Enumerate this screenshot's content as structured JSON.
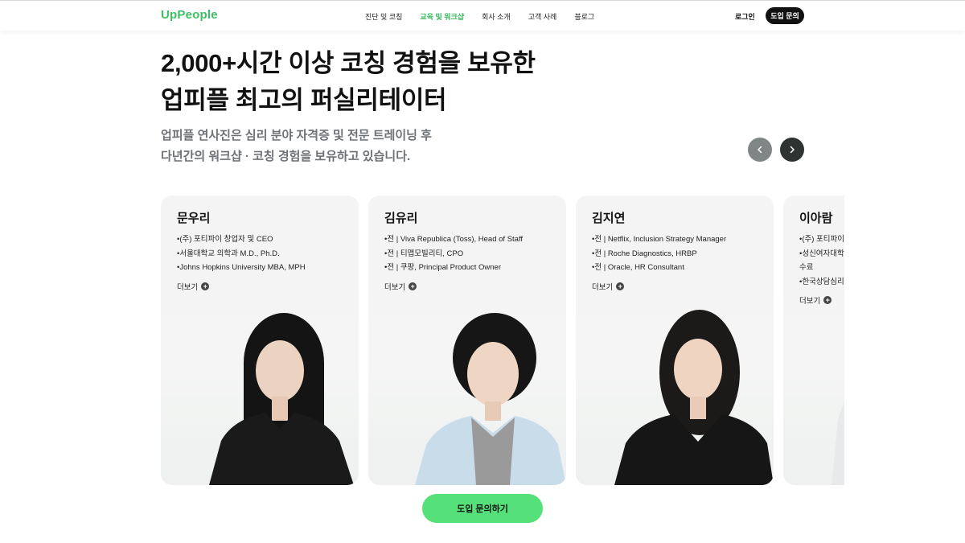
{
  "header": {
    "logo": "UpPeople",
    "nav": [
      {
        "label": "진단 및 코칭"
      },
      {
        "label": "교육 및 워크샵"
      },
      {
        "label": "회사 소개"
      },
      {
        "label": "고객 사례"
      },
      {
        "label": "블로그"
      }
    ],
    "active_nav": "교육 및 워크샵",
    "login": "로그인",
    "cta": "도입 문의"
  },
  "hero": {
    "line1": "2,000+시간 이상 코칭 경험을 보유한",
    "line2": "업피플 최고의 퍼실리테이터",
    "sub1": "업피플 연사진은 심리 분야 자격증 및 전문 트레이닝 후",
    "sub2": "다년간의 워크샵 · 코칭 경험을 보유하고 있습니다."
  },
  "carousel": {
    "prev_icon": "chevron-left-icon",
    "next_icon": "chevron-right-icon",
    "cards": [
      {
        "name": "문우리",
        "bullets": [
          "•(주) 포티파이 창업자 및 CEO",
          "•서울대학교 의학과 M.D., Ph.D.",
          "•Johns Hopkins University MBA, MPH"
        ],
        "more": "더보기"
      },
      {
        "name": "김유리",
        "bullets": [
          "•전 | Viva Republica (Toss), Head of Staff",
          "•전 | 티맵모빌리티, CPO",
          "•전 | 쿠팡, Principal Product Owner"
        ],
        "more": "더보기"
      },
      {
        "name": "김지연",
        "bullets": [
          "•전 | Netflix, Inclusion Strategy Manager",
          "•전 | Roche Diagnostics, HRBP",
          "•전 | Oracle, HR Consultant"
        ],
        "more": "더보기"
      },
      {
        "name": "이아람",
        "bullets": [
          "•(주) 포티파이",
          "•성신여자대학",
          "수료",
          "•한국상담심리"
        ],
        "more": "더보기"
      }
    ]
  },
  "footer_cta": "도입 문의하기",
  "colors": {
    "brand_green": "#3fbf63",
    "cta_green": "#55e07a",
    "dark": "#111111"
  }
}
